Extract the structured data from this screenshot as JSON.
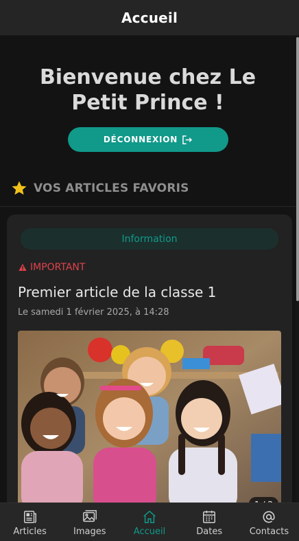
{
  "header": {
    "title": "Accueil"
  },
  "welcome": {
    "title": "Bienvenue chez Le Petit Prince !",
    "logout_label": "DÉCONNEXION"
  },
  "favorites": {
    "title": "VOS ARTICLES FAVORIS",
    "star_color": "#f2c21a"
  },
  "article": {
    "category": "Information",
    "badge": "IMPORTANT",
    "title": "Premier article de la classe 1",
    "date": "Le samedi 1 février 2025, à 14:28",
    "image_counter": "1 / 2",
    "image_subject": "children-laughing-photo"
  },
  "nav": {
    "active": "Accueil",
    "items": [
      {
        "label": "Articles",
        "icon": "newspaper-icon"
      },
      {
        "label": "Images",
        "icon": "image-icon"
      },
      {
        "label": "Accueil",
        "icon": "home-icon"
      },
      {
        "label": "Dates",
        "icon": "calendar-icon"
      },
      {
        "label": "Contacts",
        "icon": "at-icon"
      }
    ]
  },
  "colors": {
    "accent": "#11998a",
    "important": "#e0424c",
    "background": "#131313",
    "card": "#222222"
  }
}
